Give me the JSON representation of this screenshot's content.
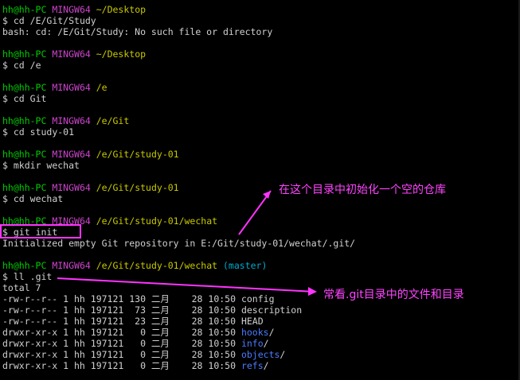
{
  "terminal": {
    "prompt": {
      "user_host": "hh@hh-PC",
      "shell": "MINGW64",
      "symbol": "$"
    },
    "blocks": [
      {
        "path": "~/Desktop",
        "command": "cd /E/Git/Study"
      },
      {
        "output": "bash: cd: /E/Git/Study: No such file or directory"
      },
      {
        "path": "~/Desktop",
        "command": "cd /e"
      },
      {
        "path": "/e",
        "command": "cd Git"
      },
      {
        "path": "/e/Git",
        "command": "cd study-01"
      },
      {
        "path": "/e/Git/study-01",
        "command": "mkdir wechat"
      },
      {
        "path": "/e/Git/study-01",
        "command": "cd wechat"
      },
      {
        "path": "/e/Git/study-01/wechat",
        "command": "git init"
      },
      {
        "output": "Initialized empty Git repository in E:/Git/study-01/wechat/.git/"
      },
      {
        "path": "/e/Git/study-01/wechat",
        "branch": "(master)",
        "command": "ll .git"
      }
    ],
    "listing": {
      "total": "total 7",
      "rows": [
        {
          "perms": "-rw-r--r--",
          "links": "1",
          "owner": "hh",
          "group": "197121",
          "size": "130",
          "month": "二月",
          "day": "28",
          "time": "10:50",
          "name": "config",
          "is_dir": false
        },
        {
          "perms": "-rw-r--r--",
          "links": "1",
          "owner": "hh",
          "group": "197121",
          "size": "73",
          "month": "二月",
          "day": "28",
          "time": "10:50",
          "name": "description",
          "is_dir": false
        },
        {
          "perms": "-rw-r--r--",
          "links": "1",
          "owner": "hh",
          "group": "197121",
          "size": "23",
          "month": "二月",
          "day": "28",
          "time": "10:50",
          "name": "HEAD",
          "is_dir": false
        },
        {
          "perms": "drwxr-xr-x",
          "links": "1",
          "owner": "hh",
          "group": "197121",
          "size": "0",
          "month": "二月",
          "day": "28",
          "time": "10:50",
          "name": "hooks",
          "suffix": "/",
          "is_dir": true
        },
        {
          "perms": "drwxr-xr-x",
          "links": "1",
          "owner": "hh",
          "group": "197121",
          "size": "0",
          "month": "二月",
          "day": "28",
          "time": "10:50",
          "name": "info",
          "suffix": "/",
          "is_dir": true
        },
        {
          "perms": "drwxr-xr-x",
          "links": "1",
          "owner": "hh",
          "group": "197121",
          "size": "0",
          "month": "二月",
          "day": "28",
          "time": "10:50",
          "name": "objects",
          "suffix": "/",
          "is_dir": true
        },
        {
          "perms": "drwxr-xr-x",
          "links": "1",
          "owner": "hh",
          "group": "197121",
          "size": "0",
          "month": "二月",
          "day": "28",
          "time": "10:50",
          "name": "refs",
          "suffix": "/",
          "is_dir": true
        }
      ]
    }
  },
  "annotations": {
    "init_note": "在这个目录中初始化一个空的仓库",
    "ll_note": "常看.git目录中的文件和目录"
  },
  "colors": {
    "background": "#000000",
    "user_host": "#00cc00",
    "shell": "#cc44cc",
    "path": "#c8c800",
    "branch": "#00aacc",
    "dir_name": "#4a7cff",
    "annotation": "#ff44ff"
  }
}
